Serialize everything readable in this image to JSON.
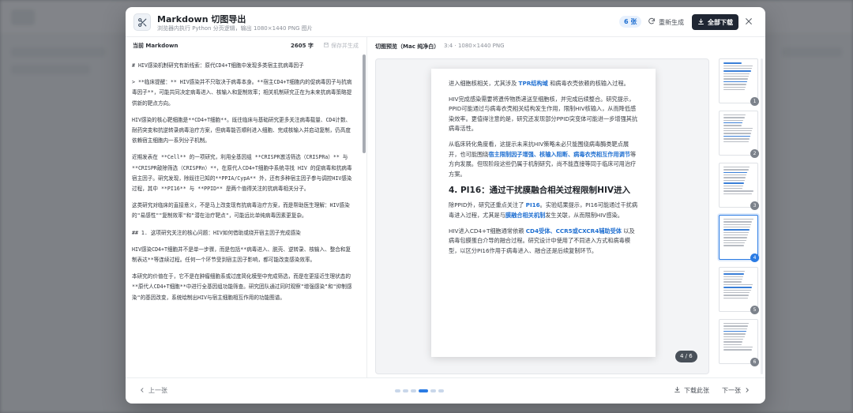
{
  "modal": {
    "title": "Markdown 切图导出",
    "subtitle": "浏览器内执行 Python 分页逻辑，输出 1080×1440 PNG 图片",
    "count_badge": "6 张",
    "regenerate_label": "重新生成",
    "download_all_label": "全部下载"
  },
  "editor_panel": {
    "label": "当前 Markdown",
    "char_count": "2605 字",
    "save_label": "保存并生成",
    "lines": [
      "# HIV感染机制研究有新线索：原代CD4+T细胞中发现多类宿主抗病毒因子",
      "> **临床提醒：** HIV感染并不只取决于病毒本身。**宿主CD4+T细胞内的促病毒因子与抗病毒因子**，可能共同决定病毒进入、核输入和复制效率；相关机制研究正在为未来抗病毒策略提供新的靶点方向。",
      "HIV感染的核心靶细胞是**CD4+T细胞**。既往临床与基础研究更多关注病毒载量、CD4计数、耐药突变和抗逆转录病毒治疗方案，但病毒能否顺利进入细胞、完成核输入并启动复制，仍高度依赖宿主细胞内一系列分子机制。",
      "近期发表在 **Cell** 的一项研究，利用全基因组 **CRISPR激活筛选（CRISPRa）** 与 **CRISPR敲除筛选（CRISPRn）**，在原代人CD4+T细胞中系统寻找 HIV 的促病毒和抗病毒宿主因子。研究发现，除既往已知的**PPIA/CypA** 外，还有多种宿主因子参与调控HIV感染过程，其中 **PI16** 与 **PPID** 是两个值得关注的抗病毒相关分子。",
      "这类研究对临床的直接意义，不是马上改变现有抗病毒治疗方案，而是帮助医生理解：HIV感染的\"易感性\"\"复制效率\"和\"潜在治疗靶点\"，可能远比单纯病毒因素更复杂。",
      "## 1. 这项研究关注的核心问题：HIV如何借助或绕开宿主因子完成感染",
      "HIV感染CD4+T细胞并不是单一步骤，而是包括**病毒进入、脱壳、逆转录、核输入、整合和复制表达**等连续过程。任何一个环节受到宿主因子影响，都可能改变感染效率。",
      "本研究的价值在于，它不是在肿瘤细胞系或过度简化模型中完成筛选，而是在更接近生理状态的**原代人CD4+T细胞**中进行全基因组功能筛查。研究团队通过同时观察\"增强感染\"和\"抑制感染\"的基因改变，系统绘制出HIV与宿主细胞相互作用的功能图谱。"
    ]
  },
  "preview_panel": {
    "label": "切图预览（Mac 纯净白）",
    "dims": "3:4 · 1080×1440 PNG",
    "page_indicator": "4 / 6",
    "p1_a": "进入细胞核相关，尤其涉及 ",
    "p1_hl": "TPR结构域",
    "p1_b": " 和病毒衣壳依赖的核输入过程。",
    "p2": "HIV完成感染需要将遗传物质递送至细胞核，并完成后续整合。研究提示，PPID可能通过与病毒衣壳相关结构发生作用，限制HIV核输入，从而降低感染效率。更值得注意的是，研究还发现部分PPID突变体可能进一步增强其抗病毒活性。",
    "p3_a": "从临床转化角度看，这提示未来抗HIV策略未必只能围绕病毒酶类靶点展开，也可能围绕",
    "p3_hl": "宿主限制因子增强、核输入阻断、病毒衣壳相互作用调节",
    "p3_b": "等方向发展。但现阶段这些仍属于机制研究，尚不能直接等同于临床可用治疗方案。",
    "h3": "4. PI16：通过干扰膜融合相关过程限制HIV进入",
    "p4_a": "除PPID外，研究还重点关注了 ",
    "p4_hl1": "PI16",
    "p4_b": "。实验结果提示，PI16可能通过干扰病毒进入过程，尤其是与",
    "p4_hl2": "膜融合相关机制",
    "p4_c": "发生关联，从而限制HIV感染。",
    "p5_a": "HIV进入CD4+T细胞通常依赖 ",
    "p5_hl": "CD4受体、CCR5或CXCR4辅助受体",
    "p5_b": " 以及病毒包膜蛋白介导的融合过程。研究设计中使用了不同进入方式和病毒模型，以区分PI16作用于病毒进入、融合还是后续复制环节。",
    "thumbnails": [
      {
        "num": "1"
      },
      {
        "num": "2"
      },
      {
        "num": "3"
      },
      {
        "num": "4"
      },
      {
        "num": "5"
      },
      {
        "num": "6"
      }
    ],
    "active_thumbnail": 4
  },
  "footer": {
    "prev_label": "上一张",
    "download_page_label": "下载此张",
    "next_label": "下一张",
    "dots_total": 6,
    "dots_active": 4
  },
  "colors": {
    "accent": "#2a7be4",
    "highlight_text": "#1f6fd1",
    "primary_button": "#1f2633"
  }
}
